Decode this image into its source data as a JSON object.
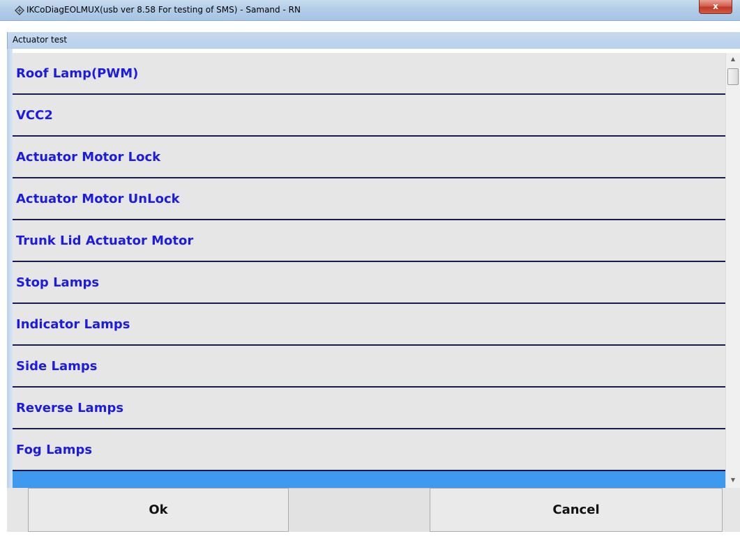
{
  "window": {
    "title": "IKCoDiagEOLMUX(usb ver 8.58 For testing of SMS)  - Samand - RN",
    "close_label": "x",
    "icon": "diagnostic-app-icon"
  },
  "subheader": {
    "label": "Actuator test"
  },
  "actuator_list": {
    "items": [
      {
        "label": "Roof Lamp(PWM)"
      },
      {
        "label": "VCC2"
      },
      {
        "label": "Actuator Motor Lock"
      },
      {
        "label": "Actuator Motor UnLock"
      },
      {
        "label": "Trunk Lid Actuator Motor"
      },
      {
        "label": "Stop Lamps"
      },
      {
        "label": "Indicator Lamps"
      },
      {
        "label": "Side Lamps"
      },
      {
        "label": "Reverse Lamps"
      },
      {
        "label": "Fog Lamps"
      },
      {
        "label": "",
        "selected": true
      }
    ],
    "selected_color": "#3f9aef",
    "item_text_color": "#1c1ce0"
  },
  "scrollbar": {
    "up_arrow": "▲",
    "down_arrow": "▼"
  },
  "buttons": {
    "ok_label": "Ok",
    "cancel_label": "Cancel"
  }
}
